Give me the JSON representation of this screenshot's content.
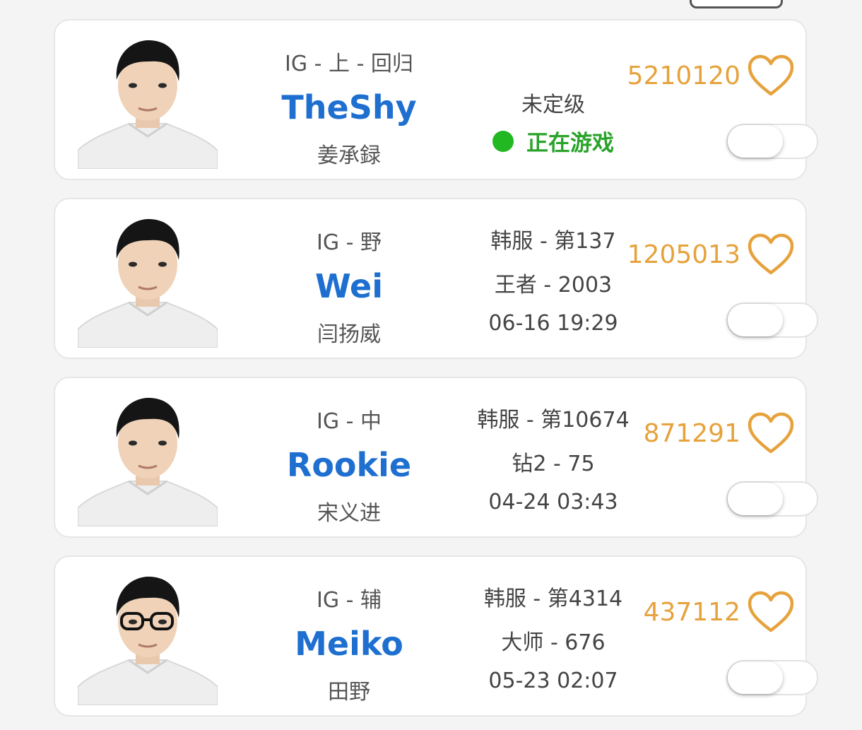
{
  "accent_color": "#1e6fd0",
  "like_color": "#e6a23c",
  "status_color": "#2aa32a",
  "players": [
    {
      "meta": "IG - 上 - 回归",
      "ign": "TheShy",
      "real_name": "姜承録",
      "rank_lines": [
        "未定级"
      ],
      "status": "正在游戏",
      "likes": "5210120",
      "toggle_on": false,
      "has_glasses": false
    },
    {
      "meta": "IG - 野",
      "ign": "Wei",
      "real_name": "闫扬威",
      "rank_lines": [
        "韩服 - 第137",
        "王者 - 2003",
        "06-16 19:29"
      ],
      "status": "",
      "likes": "1205013",
      "toggle_on": false,
      "has_glasses": false
    },
    {
      "meta": "IG - 中",
      "ign": "Rookie",
      "real_name": "宋义进",
      "rank_lines": [
        "韩服 - 第10674",
        "钻2 - 75",
        "04-24 03:43"
      ],
      "status": "",
      "likes": "871291",
      "toggle_on": false,
      "has_glasses": false
    },
    {
      "meta": "IG - 辅",
      "ign": "Meiko",
      "real_name": "田野",
      "rank_lines": [
        "韩服 - 第4314",
        "大师 - 676",
        "05-23 02:07"
      ],
      "status": "",
      "likes": "437112",
      "toggle_on": false,
      "has_glasses": true
    }
  ]
}
